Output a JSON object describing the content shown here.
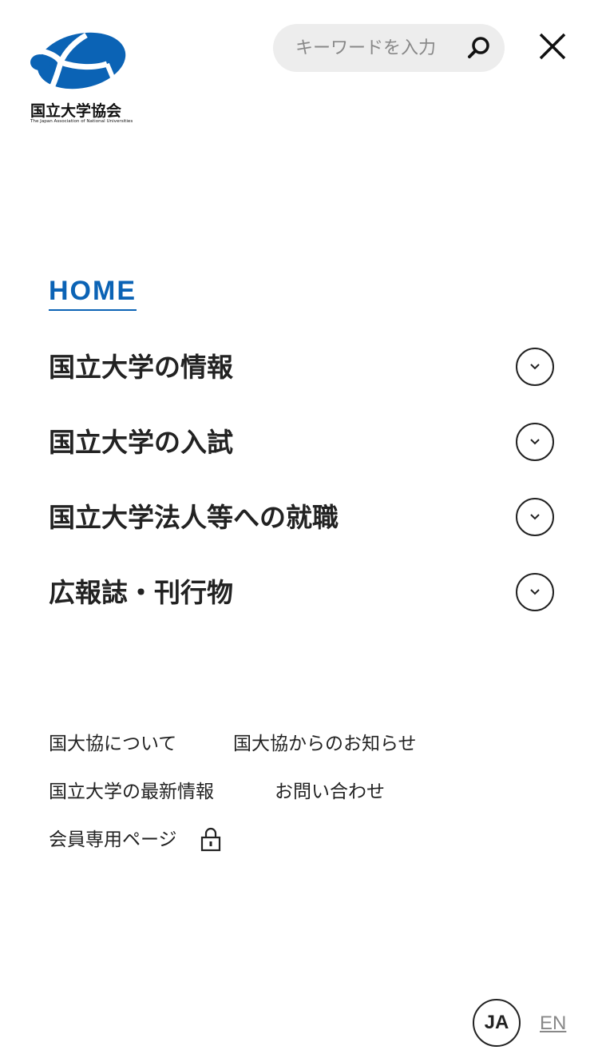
{
  "logo": {
    "name": "国立大学協会",
    "subtitle": "The Japan Association of National Universities",
    "brand_color": "#0b63b5"
  },
  "search": {
    "placeholder": "キーワードを入力",
    "value": "",
    "icon": "search-icon"
  },
  "close": {
    "icon": "close-icon"
  },
  "menu": {
    "home_label": "HOME",
    "items": [
      {
        "label": "国立大学の情報",
        "icon": "chevron-down-icon"
      },
      {
        "label": "国立大学の入試",
        "icon": "chevron-down-icon"
      },
      {
        "label": "国立大学法人等への就職",
        "icon": "chevron-down-icon"
      },
      {
        "label": "広報誌・刊行物",
        "icon": "chevron-down-icon"
      }
    ]
  },
  "sub_links": {
    "about": "国大協について",
    "news": "国大協からのお知らせ",
    "latest": "国立大学の最新情報",
    "contact": "お問い合わせ",
    "members": "会員専用ページ",
    "members_icon": "lock-icon"
  },
  "language": {
    "ja": "JA",
    "en": "EN",
    "active": "JA"
  }
}
